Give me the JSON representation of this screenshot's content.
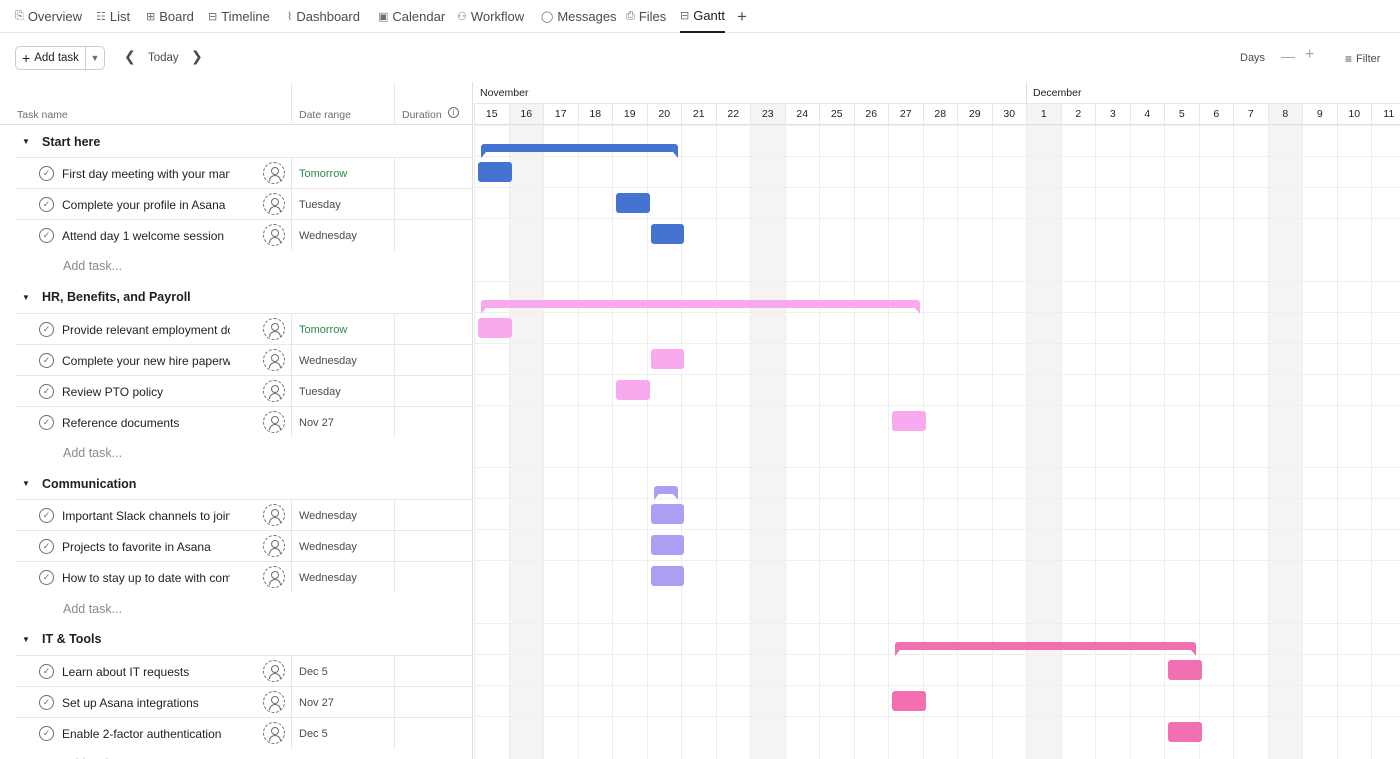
{
  "tabs": [
    {
      "label": "Overview",
      "icon": "overview-icon",
      "glyph": "⎘"
    },
    {
      "label": "List",
      "icon": "list-icon",
      "glyph": "☷"
    },
    {
      "label": "Board",
      "icon": "board-icon",
      "glyph": "⊞"
    },
    {
      "label": "Timeline",
      "icon": "timeline-icon",
      "glyph": "⊟"
    },
    {
      "label": "Dashboard",
      "icon": "dashboard-icon",
      "glyph": "⌇"
    },
    {
      "label": "Calendar",
      "icon": "calendar-icon",
      "glyph": "▣"
    },
    {
      "label": "Workflow",
      "icon": "workflow-icon",
      "glyph": "⚇"
    },
    {
      "label": "Messages",
      "icon": "messages-icon",
      "glyph": "◯"
    },
    {
      "label": "Files",
      "icon": "files-icon",
      "glyph": "⎙"
    },
    {
      "label": "Gantt",
      "icon": "gantt-icon",
      "glyph": "⊟"
    }
  ],
  "toolbar": {
    "add_task_label": "Add task",
    "today_label": "Today",
    "days_label": "Days",
    "filter_label": "Filter"
  },
  "columns": {
    "task_name": "Task name",
    "date_range": "Date range",
    "duration": "Duration"
  },
  "add_task_placeholder": "Add task...",
  "timeline": {
    "months": [
      {
        "label": "November"
      },
      {
        "label": "December"
      }
    ],
    "days": [
      "15",
      "16",
      "17",
      "18",
      "19",
      "20",
      "21",
      "22",
      "23",
      "24",
      "25",
      "26",
      "27",
      "28",
      "29",
      "30",
      "1",
      "2",
      "3",
      "4",
      "5",
      "6",
      "7",
      "8",
      "9",
      "10",
      "11"
    ],
    "weekend_days": [
      "16",
      "23",
      "1",
      "8"
    ]
  },
  "colors": {
    "blue": "#4573d2",
    "pink_light": "#f9aaef",
    "purple": "#aa9ff2",
    "pink": "#f26fb2"
  },
  "sections": [
    {
      "title": "Start here",
      "color": "#4573d2",
      "span_days": [
        "15",
        "20"
      ],
      "tasks": [
        {
          "name": "First day meeting with your manager",
          "date": "Tomorrow",
          "green": true,
          "bar_day": "15"
        },
        {
          "name": "Complete your profile in Asana",
          "date": "Tuesday",
          "green": false,
          "bar_day": "19"
        },
        {
          "name": "Attend day 1 welcome session",
          "date": "Wednesday",
          "green": false,
          "bar_day": "20"
        }
      ]
    },
    {
      "title": "HR, Benefits, and Payroll",
      "color": "#f9aaef",
      "span_days": [
        "15",
        "27"
      ],
      "tasks": [
        {
          "name": "Provide relevant employment documents",
          "date": "Tomorrow",
          "green": true,
          "bar_day": "15"
        },
        {
          "name": "Complete your new hire paperwork",
          "date": "Wednesday",
          "green": false,
          "bar_day": "20"
        },
        {
          "name": "Review PTO policy",
          "date": "Tuesday",
          "green": false,
          "bar_day": "19"
        },
        {
          "name": "Reference documents",
          "date": "Nov 27",
          "green": false,
          "bar_day": "27"
        }
      ]
    },
    {
      "title": "Communication",
      "color": "#aa9ff2",
      "span_days": [
        "20",
        "20"
      ],
      "tasks": [
        {
          "name": "Important Slack channels to join",
          "date": "Wednesday",
          "green": false,
          "bar_day": "20"
        },
        {
          "name": "Projects to favorite in Asana",
          "date": "Wednesday",
          "green": false,
          "bar_day": "20"
        },
        {
          "name": "How to stay up to date with company news",
          "date": "Wednesday",
          "green": false,
          "bar_day": "20"
        }
      ]
    },
    {
      "title": "IT & Tools",
      "color": "#f26fb2",
      "span_days": [
        "27",
        "5"
      ],
      "tasks": [
        {
          "name": "Learn about IT requests",
          "date": "Dec 5",
          "green": false,
          "bar_day": "5"
        },
        {
          "name": "Set up Asana integrations",
          "date": "Nov 27",
          "green": false,
          "bar_day": "27"
        },
        {
          "name": "Enable 2-factor authentication",
          "date": "Dec 5",
          "green": false,
          "bar_day": "5"
        }
      ]
    }
  ]
}
